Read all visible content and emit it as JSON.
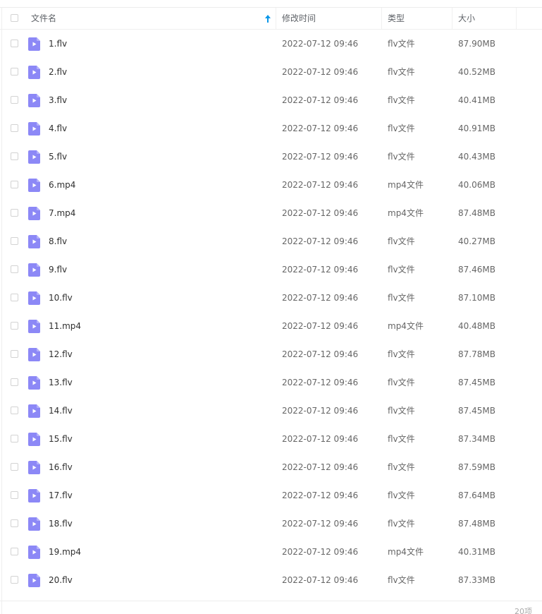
{
  "header": {
    "name": "文件名",
    "modified": "修改时间",
    "type": "类型",
    "size": "大小"
  },
  "colors": {
    "accent": "#0a97e8",
    "file_icon": "#8c88f6"
  },
  "files": [
    {
      "name": "1.flv",
      "time": "2022-07-12 09:46",
      "type": "flv文件",
      "size": "87.90MB"
    },
    {
      "name": "2.flv",
      "time": "2022-07-12 09:46",
      "type": "flv文件",
      "size": "40.52MB"
    },
    {
      "name": "3.flv",
      "time": "2022-07-12 09:46",
      "type": "flv文件",
      "size": "40.41MB"
    },
    {
      "name": "4.flv",
      "time": "2022-07-12 09:46",
      "type": "flv文件",
      "size": "40.91MB"
    },
    {
      "name": "5.flv",
      "time": "2022-07-12 09:46",
      "type": "flv文件",
      "size": "40.43MB"
    },
    {
      "name": "6.mp4",
      "time": "2022-07-12 09:46",
      "type": "mp4文件",
      "size": "40.06MB"
    },
    {
      "name": "7.mp4",
      "time": "2022-07-12 09:46",
      "type": "mp4文件",
      "size": "87.48MB"
    },
    {
      "name": "8.flv",
      "time": "2022-07-12 09:46",
      "type": "flv文件",
      "size": "40.27MB"
    },
    {
      "name": "9.flv",
      "time": "2022-07-12 09:46",
      "type": "flv文件",
      "size": "87.46MB"
    },
    {
      "name": "10.flv",
      "time": "2022-07-12 09:46",
      "type": "flv文件",
      "size": "87.10MB"
    },
    {
      "name": "11.mp4",
      "time": "2022-07-12 09:46",
      "type": "mp4文件",
      "size": "40.48MB"
    },
    {
      "name": "12.flv",
      "time": "2022-07-12 09:46",
      "type": "flv文件",
      "size": "87.78MB"
    },
    {
      "name": "13.flv",
      "time": "2022-07-12 09:46",
      "type": "flv文件",
      "size": "87.45MB"
    },
    {
      "name": "14.flv",
      "time": "2022-07-12 09:46",
      "type": "flv文件",
      "size": "87.45MB"
    },
    {
      "name": "15.flv",
      "time": "2022-07-12 09:46",
      "type": "flv文件",
      "size": "87.34MB"
    },
    {
      "name": "16.flv",
      "time": "2022-07-12 09:46",
      "type": "flv文件",
      "size": "87.59MB"
    },
    {
      "name": "17.flv",
      "time": "2022-07-12 09:46",
      "type": "flv文件",
      "size": "87.64MB"
    },
    {
      "name": "18.flv",
      "time": "2022-07-12 09:46",
      "type": "flv文件",
      "size": "87.48MB"
    },
    {
      "name": "19.mp4",
      "time": "2022-07-12 09:46",
      "type": "mp4文件",
      "size": "40.31MB"
    },
    {
      "name": "20.flv",
      "time": "2022-07-12 09:46",
      "type": "flv文件",
      "size": "87.33MB"
    }
  ],
  "footer": {
    "count": "20项"
  }
}
